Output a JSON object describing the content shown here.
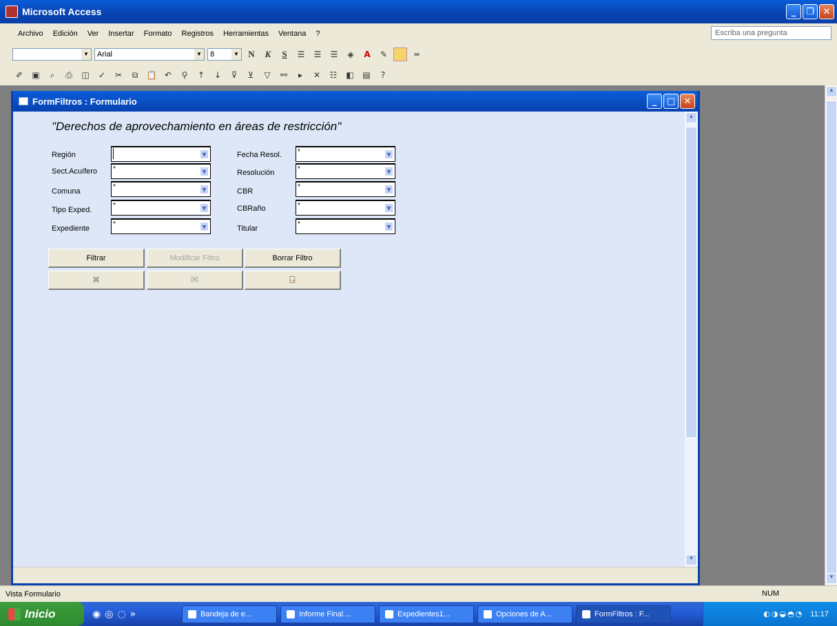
{
  "app": {
    "title": "Microsoft Access"
  },
  "menu": [
    "Archivo",
    "Edición",
    "Ver",
    "Insertar",
    "Formato",
    "Registros",
    "Herramientas",
    "Ventana",
    "?"
  ],
  "ask_placeholder": "Escriba una pregunta",
  "toolbar": {
    "font_name": "Arial",
    "font_size": "8",
    "bold": "N",
    "italic": "K",
    "underline": "S"
  },
  "form": {
    "window_title": "FormFiltros : Formulario",
    "heading": "\"Derechos de aprovechamiento en áreas de restricción\"",
    "left_fields": [
      {
        "label": "Región",
        "value": ""
      },
      {
        "label": "Sect.Acuífero",
        "value": "*"
      },
      {
        "label": "Comuna",
        "value": "*"
      },
      {
        "label": "Tipo Exped.",
        "value": "*"
      },
      {
        "label": "Expediente",
        "value": "*"
      }
    ],
    "right_fields": [
      {
        "label": "Fecha Resol.",
        "value": "*"
      },
      {
        "label": "Resolución",
        "value": "*"
      },
      {
        "label": "CBR",
        "value": "*"
      },
      {
        "label": "CBRaño",
        "value": "*"
      },
      {
        "label": "Titular",
        "value": "*"
      }
    ],
    "buttons": {
      "filter": "Filtrar",
      "modify": "Modificar Filtro",
      "clear": "Borrar Filtro"
    }
  },
  "status": {
    "text": "Vista Formulario",
    "num": "NUM"
  },
  "taskbar": {
    "start": "Inicio",
    "tasks": [
      "Bandeja de e...",
      "Informe Final ...",
      "Expedientes1...",
      "Opciones de A...",
      "FormFiltros : F..."
    ],
    "clock": "11:17"
  }
}
